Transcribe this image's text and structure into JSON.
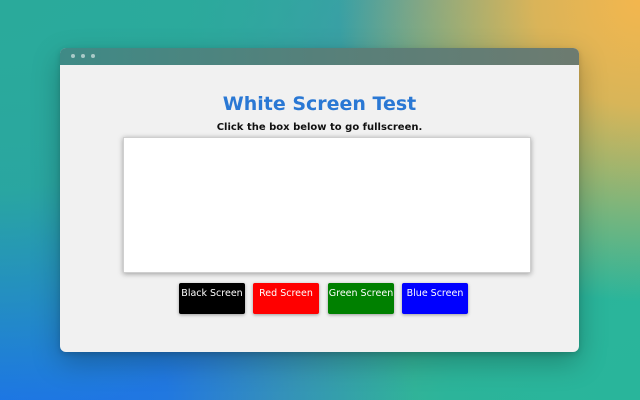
{
  "page": {
    "title": "White Screen Test",
    "subtitle": "Click the box below to go fullscreen."
  },
  "buttons": [
    {
      "label": "Black Screen",
      "bg": "#000000",
      "fg": "#ffffff"
    },
    {
      "label": "Red Screen",
      "bg": "#ff0000",
      "fg": "#ffffff"
    },
    {
      "label": "Green Screen",
      "bg": "#008000",
      "fg": "#ffffff"
    },
    {
      "label": "Blue Screen",
      "bg": "#0000ff",
      "fg": "#ffffff"
    }
  ],
  "colors": {
    "title": "#2a78d4",
    "screen_box": "#ffffff",
    "window_background": "#f1f1f1"
  }
}
